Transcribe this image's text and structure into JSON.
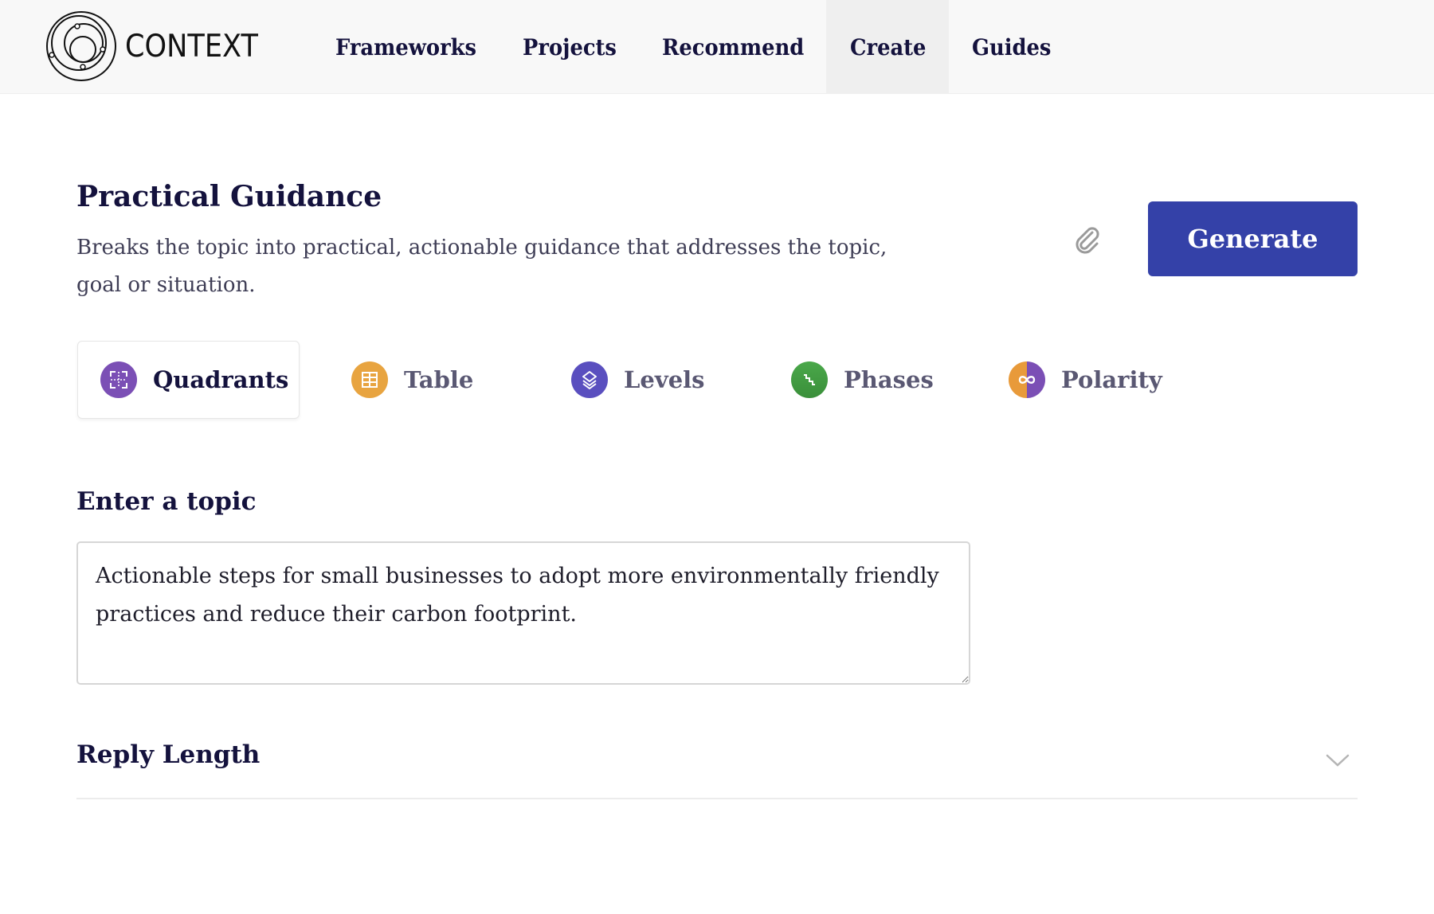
{
  "nav": {
    "brand": "CONTEXT",
    "items": [
      {
        "label": "Frameworks",
        "active": false
      },
      {
        "label": "Projects",
        "active": false
      },
      {
        "label": "Recommend",
        "active": false
      },
      {
        "label": "Create",
        "active": true
      },
      {
        "label": "Guides",
        "active": false
      }
    ]
  },
  "header": {
    "title": "Practical Guidance",
    "description": "Breaks the topic into practical, actionable guidance that addresses the topic, goal or situation.",
    "attach_icon": "paperclip-icon",
    "generate_label": "Generate"
  },
  "tabs": [
    {
      "label": "Quadrants",
      "icon": "quadrants-icon",
      "color": "#7b4fb5",
      "active": true
    },
    {
      "label": "Table",
      "icon": "table-icon",
      "color": "#e8a440",
      "active": false
    },
    {
      "label": "Levels",
      "icon": "layers-icon",
      "color": "#5a4fbf",
      "active": false
    },
    {
      "label": "Phases",
      "icon": "stairs-icon",
      "color": "#3d9a3d",
      "active": false
    },
    {
      "label": "Polarity",
      "icon": "infinity-icon",
      "color_left": "#e89a3a",
      "color_right": "#7b4fb5",
      "active": false
    }
  ],
  "topic": {
    "label": "Enter a topic",
    "value": "Actionable steps for small businesses to adopt more environmentally friendly practices and reduce their carbon footprint."
  },
  "reply_length": {
    "label": "Reply Length",
    "expanded": false
  },
  "colors": {
    "primary": "#3441a8",
    "text": "#14123d",
    "nav_bg": "#f8f8f8",
    "nav_active_bg": "#efefef"
  }
}
